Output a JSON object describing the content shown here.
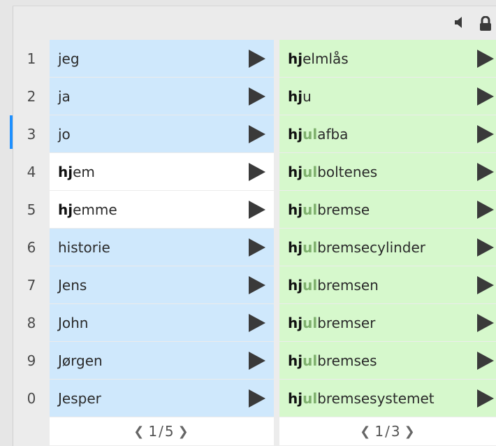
{
  "numbers": [
    "1",
    "2",
    "3",
    "4",
    "5",
    "6",
    "7",
    "8",
    "9",
    "0"
  ],
  "left_list": {
    "rows": [
      {
        "prefix": "",
        "rest": "jeg",
        "highlight": "blue"
      },
      {
        "prefix": "",
        "rest": "ja",
        "highlight": "blue"
      },
      {
        "prefix": "",
        "rest": "jo",
        "highlight": "blue"
      },
      {
        "prefix": "hj",
        "rest": "em",
        "highlight": "white"
      },
      {
        "prefix": "hj",
        "rest": "emme",
        "highlight": "white"
      },
      {
        "prefix": "",
        "rest": "historie",
        "highlight": "blue"
      },
      {
        "prefix": "",
        "rest": "Jens",
        "highlight": "blue"
      },
      {
        "prefix": "",
        "rest": "John",
        "highlight": "blue"
      },
      {
        "prefix": "",
        "rest": "Jørgen",
        "highlight": "blue"
      },
      {
        "prefix": "",
        "rest": "Jesper",
        "highlight": "blue"
      }
    ],
    "page_current": "1",
    "page_total": "5"
  },
  "right_list": {
    "rows": [
      {
        "p1": "hj",
        "g": "",
        "rest": "elmlås"
      },
      {
        "p1": "hj",
        "g": "",
        "rest": "u"
      },
      {
        "p1": "hj",
        "g": "ul",
        "rest": "afba"
      },
      {
        "p1": "hj",
        "g": "ul",
        "rest": "boltenes"
      },
      {
        "p1": "hj",
        "g": "ul",
        "rest": "bremse"
      },
      {
        "p1": "hj",
        "g": "ul",
        "rest": "bremsecylinder"
      },
      {
        "p1": "hj",
        "g": "ul",
        "rest": "bremsen"
      },
      {
        "p1": "hj",
        "g": "ul",
        "rest": "bremser"
      },
      {
        "p1": "hj",
        "g": "ul",
        "rest": "bremses"
      },
      {
        "p1": "hj",
        "g": "ul",
        "rest": "bremsesystemet"
      }
    ],
    "page_current": "1",
    "page_total": "3"
  },
  "icons": {
    "speaker": "speaker-icon",
    "lock": "lock-icon",
    "play": "play-icon",
    "prev": "chevron-left-icon",
    "next": "chevron-right-icon"
  },
  "colors": {
    "left_bg": "#cfe8fc",
    "right_bg": "#d6f8cc",
    "selected_marker": "#1e90ff"
  }
}
